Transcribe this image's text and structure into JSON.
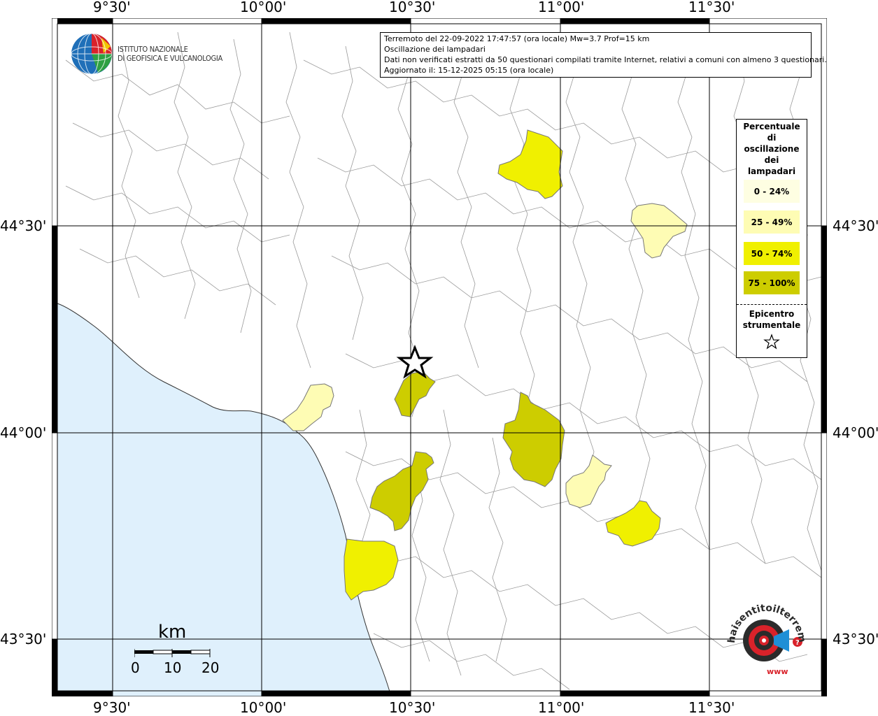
{
  "info": {
    "line1": "Terremoto del 22-09-2022 17:47:57 (ora locale) Mw=3.7 Prof=15 km",
    "line2": "Oscillazione dei lampadari",
    "line3": "Dati non verificati estratti da 50 questionari compilati tramite Internet, relativi a comuni con almeno 3 questionari.",
    "line4": "Aggiornato il: 15-12-2025 05:15 (ora locale)"
  },
  "axes": {
    "lon_labels": [
      "9°30'",
      "10°00'",
      "10°30'",
      "11°00'",
      "11°30'"
    ],
    "lat_labels": [
      "44°30'",
      "44°00'",
      "43°30'"
    ]
  },
  "legend": {
    "title_lines": [
      "Percentuale",
      "di",
      "oscillazione",
      "dei",
      "lampadari"
    ],
    "items": [
      {
        "label": "0 - 24%",
        "color": "#fefee2"
      },
      {
        "label": "25 - 49%",
        "color": "#fefcb4"
      },
      {
        "label": "50 - 74%",
        "color": "#f0f000"
      },
      {
        "label": "75 - 100%",
        "color": "#cdcd00"
      }
    ],
    "epicenter_lines": [
      "Epicentro",
      "strumentale"
    ]
  },
  "logo": {
    "line1": "ISTITUTO NAZIONALE",
    "line2": "DI GEOFISICA E VULCANOLOGIA"
  },
  "scale": {
    "unit": "km",
    "labels": [
      "0",
      "10",
      "20"
    ]
  },
  "watermark": {
    "text": "haisentitoilterremoto.it",
    "url": "www"
  },
  "colors": {
    "sea": "#dff0fc",
    "class_0_24": "#fefee2",
    "class_25_49": "#fefcb4",
    "class_50_74": "#f0f000",
    "class_75_100": "#cdcd00"
  }
}
